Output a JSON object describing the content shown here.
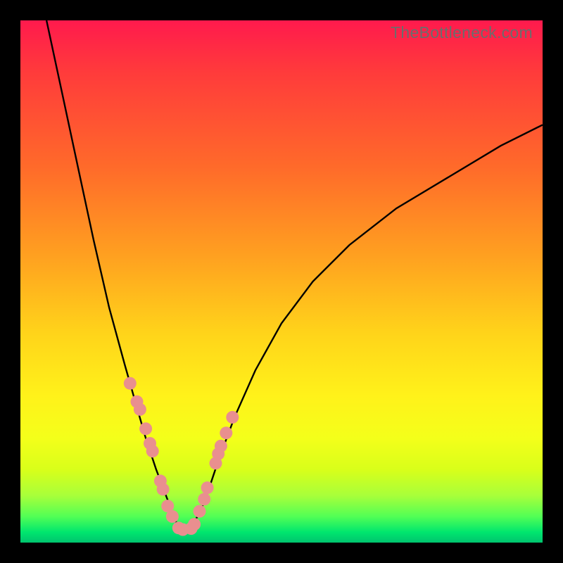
{
  "watermark": "TheBottleneck.com",
  "colors": {
    "dot": "#e98f8f",
    "curve": "#000000"
  },
  "chart_data": {
    "type": "line",
    "title": "",
    "xlabel": "",
    "ylabel": "",
    "xlim": [
      0,
      100
    ],
    "ylim": [
      0,
      100
    ],
    "description": "Bottleneck curve: steep descent from top-left to a minimum near x≈31, then a slower concave-up rise toward the right. Background gradient encodes severity (red high, green low). Salmon dots highlight sampled points near the minimum on both branches.",
    "series": [
      {
        "name": "bottleneck_curve",
        "x": [
          5,
          8,
          11,
          14,
          17,
          20,
          22,
          24,
          26,
          27.5,
          29,
          30,
          31,
          32,
          33,
          34.5,
          36,
          38,
          41,
          45,
          50,
          56,
          63,
          72,
          82,
          92,
          100
        ],
        "y": [
          100,
          86,
          72,
          58,
          45,
          34,
          27,
          20,
          14,
          10,
          6,
          3.5,
          2.5,
          2.5,
          3.5,
          6,
          10,
          16,
          24,
          33,
          42,
          50,
          57,
          64,
          70,
          76,
          80
        ]
      }
    ],
    "highlight_points": {
      "name": "sampled_dots",
      "x": [
        21.0,
        22.3,
        22.9,
        24.0,
        24.8,
        25.3,
        26.8,
        27.3,
        28.2,
        29.1,
        30.3,
        31.1,
        32.7,
        33.3,
        34.3,
        35.2,
        35.8,
        37.4,
        37.9,
        38.4,
        39.4,
        40.6
      ],
      "y": [
        30.5,
        27.0,
        25.5,
        21.8,
        19.0,
        17.5,
        11.8,
        10.2,
        7.0,
        5.0,
        2.8,
        2.5,
        2.7,
        3.5,
        6.0,
        8.3,
        10.5,
        15.2,
        17.0,
        18.5,
        21.0,
        24.0
      ]
    }
  }
}
